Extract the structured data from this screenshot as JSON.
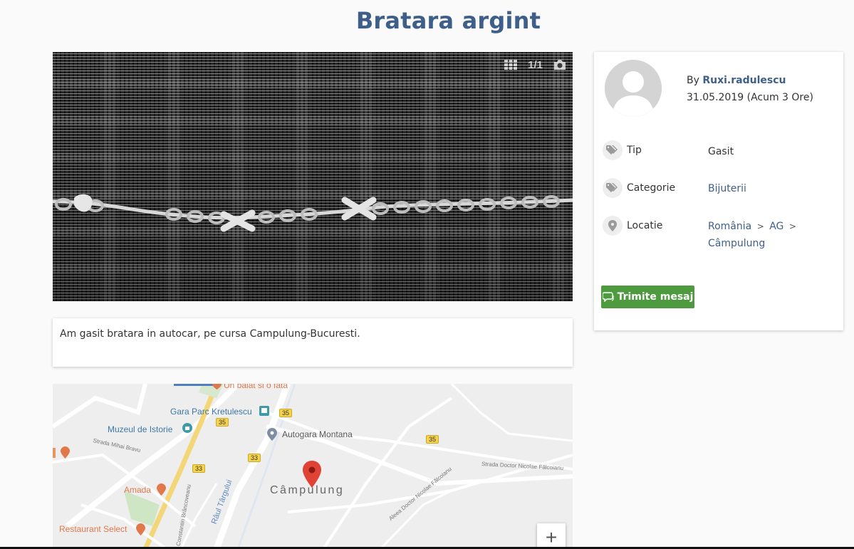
{
  "listing": {
    "title": "Bratara argint"
  },
  "gallery": {
    "counter": "1/1",
    "icons": [
      "grid-icon",
      "camera-icon"
    ]
  },
  "description": {
    "text": "Am gasit bratara in autocar, pe cursa Campulung-Bucuresti."
  },
  "map": {
    "labels": {
      "un_baiat": "Un baiat si o fata",
      "gara": "Gara Parc Kretulescu",
      "muzeul": "Muzeul de Istorie",
      "autogara": "Autogara Montana",
      "strada_mihai": "Strada Mihai Bravu",
      "strada_doctor": "Strada Doctor Nicolae Fălcoianu",
      "aleea_doctor": "Aleea Doctor Nicolae Fălcoianu",
      "amada": "Amada",
      "campulung": "Câmpulung",
      "raul_targului": "Râul Târgului",
      "constantin": "Constantin Brâncoveanu",
      "restaurant": "Restaurant Select",
      "road_35a": "35",
      "road_35b": "35",
      "road_35c": "35",
      "road_33a": "33",
      "road_33b": "33"
    },
    "zoom_in": "+"
  },
  "sidebar": {
    "by_prefix": "By",
    "author": "Ruxi.radulescu",
    "date": "31.05.2019 (Acum 3 Ore)",
    "tip_label": "Tip",
    "tip_value": "Gasit",
    "categorie_label": "Categorie",
    "categorie_value": "Bijuterii",
    "locatie_label": "Locatie",
    "loc_country": "România",
    "loc_region": "AG",
    "loc_city": "Câmpulung",
    "loc_sep": ">",
    "send_button": "Trimite mesaj"
  },
  "colors": {
    "accent": "#3e5f8a",
    "button": "#4d9a3f"
  }
}
